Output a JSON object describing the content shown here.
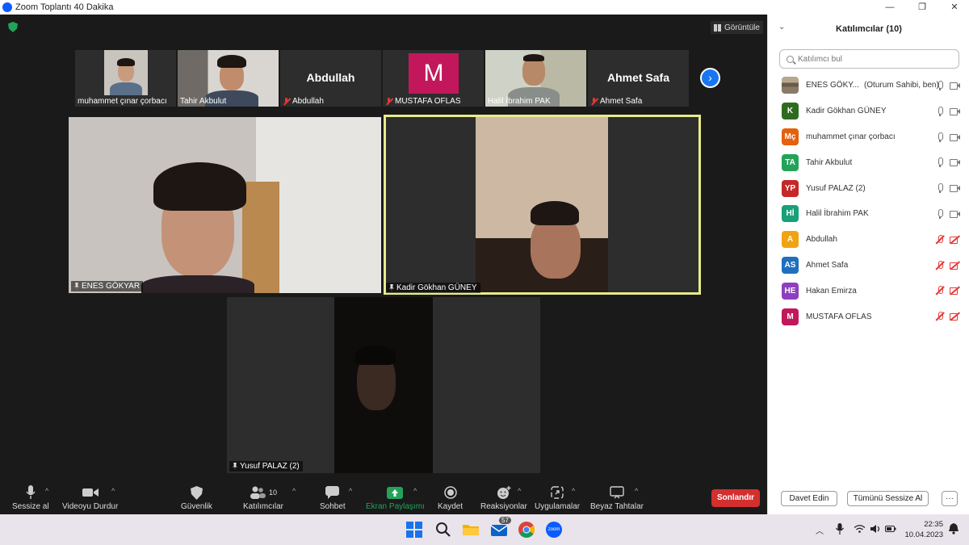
{
  "window": {
    "title": "Zoom Toplantı 40 Dakika",
    "minimize": "—",
    "restore": "❐",
    "close": "✕"
  },
  "view_button": {
    "label": "Görüntüle"
  },
  "thumbnails": [
    {
      "name": "muhammet çınar çorbacı",
      "type": "video",
      "muted": false,
      "big_label": ""
    },
    {
      "name": "Tahir Akbulut",
      "type": "video",
      "muted": false,
      "big_label": ""
    },
    {
      "name": "Abdullah",
      "type": "name",
      "muted": true,
      "big_label": "Abdullah"
    },
    {
      "name": "MUSTAFA OFLAS",
      "type": "avatar",
      "muted": true,
      "big_label": "M",
      "avatar_color": "#c2185b"
    },
    {
      "name": "Halil İbrahim PAK",
      "type": "video",
      "muted": false,
      "big_label": ""
    },
    {
      "name": "Ahmet Safa",
      "type": "name",
      "muted": true,
      "big_label": "Ahmet Safa"
    }
  ],
  "next_page_icon": "chevron-right-icon",
  "tiles": [
    {
      "name": "ENES GÖKYAR",
      "pinned": true,
      "active": false
    },
    {
      "name": "Kadir Gökhan GÜNEY",
      "pinned": true,
      "active": true
    },
    {
      "name": "Yusuf PALAZ (2)",
      "pinned": true,
      "active": false
    }
  ],
  "toolbar": {
    "mute_label": "Sessize al",
    "video_label": "Videoyu Durdur",
    "security_label": "Güvenlik",
    "participants_label": "Katılımcılar",
    "participants_count": "10",
    "chat_label": "Sohbet",
    "share_label": "Ekran Paylaşımı",
    "record_label": "Kaydet",
    "reactions_label": "Reaksiyonlar",
    "apps_label": "Uygulamalar",
    "whiteboard_label": "Beyaz Tahtalar",
    "end_label": "Sonlandır",
    "share_color": "#23a35a",
    "end_color": "#d32f2f"
  },
  "panel": {
    "title": "Katılımcılar (10)",
    "search_placeholder": "Katılımcı bul",
    "invite_label": "Davet Edin",
    "mute_all_label": "Tümünü Sessize Al",
    "more_label": "···",
    "participants": [
      {
        "name": "ENES GÖKY...",
        "note": "(Oturum Sahibi, ben)",
        "initials": "",
        "color": "#8a7a66",
        "photo": true,
        "mic": "on",
        "cam": "on"
      },
      {
        "name": "Kadir Gökhan GÜNEY",
        "note": "",
        "initials": "K",
        "color": "#2e6b1f",
        "photo": false,
        "mic": "speaking",
        "cam": "on"
      },
      {
        "name": "muhammet çınar çorbacı",
        "note": "",
        "initials": "Mç",
        "color": "#e5600f",
        "photo": false,
        "mic": "on",
        "cam": "on"
      },
      {
        "name": "Tahir Akbulut",
        "note": "",
        "initials": "TA",
        "color": "#23a35a",
        "photo": false,
        "mic": "on",
        "cam": "on"
      },
      {
        "name": "Yusuf PALAZ (2)",
        "note": "",
        "initials": "YP",
        "color": "#c62828",
        "photo": false,
        "mic": "on",
        "cam": "on"
      },
      {
        "name": "Halil İbrahim PAK",
        "note": "",
        "initials": "Hİ",
        "color": "#17a07a",
        "photo": false,
        "mic": "on",
        "cam": "on"
      },
      {
        "name": "Abdullah",
        "note": "",
        "initials": "A",
        "color": "#f2a311",
        "photo": false,
        "mic": "off",
        "cam": "off"
      },
      {
        "name": "Ahmet Safa",
        "note": "",
        "initials": "AS",
        "color": "#1f6fbf",
        "photo": false,
        "mic": "off",
        "cam": "off"
      },
      {
        "name": "Hakan Emirza",
        "note": "",
        "initials": "HE",
        "color": "#8e3fbf",
        "photo": false,
        "mic": "off",
        "cam": "off"
      },
      {
        "name": "MUSTAFA OFLAS",
        "note": "",
        "initials": "M",
        "color": "#c2185b",
        "photo": false,
        "mic": "off",
        "cam": "off"
      }
    ]
  },
  "taskbar": {
    "mail_badge": "57",
    "time": "22:35",
    "date": "10.04.2023",
    "icons": [
      "windows-start-icon",
      "search-icon",
      "file-explorer-icon",
      "mail-icon",
      "chrome-icon",
      "zoom-icon"
    ],
    "zoom_label": "zoom"
  }
}
